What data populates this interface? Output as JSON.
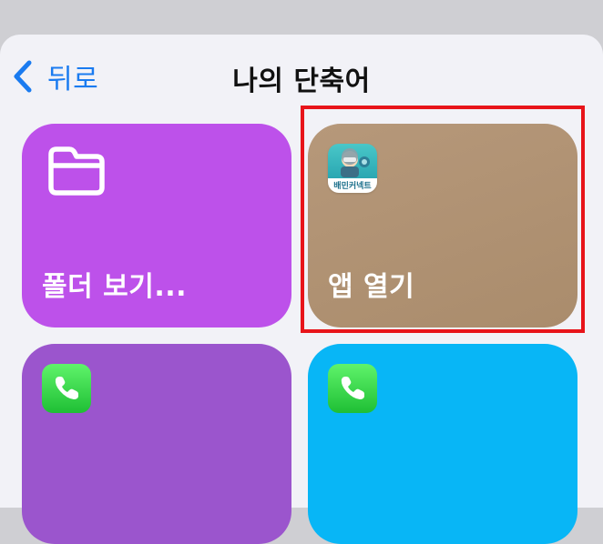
{
  "nav": {
    "back_label": "뒤로",
    "title": "나의 단축어"
  },
  "tiles": {
    "folder": {
      "label": "폴더 보기...",
      "color": "#bd51ea",
      "icon": "folder-icon"
    },
    "app": {
      "label": "앱 열기",
      "icon_text": "배민커넥트",
      "color": "#b09274",
      "icon": "app-icon"
    },
    "call1": {
      "color": "#9b55cd",
      "icon": "phone-icon"
    },
    "call2": {
      "color": "#08b6f6",
      "icon": "phone-icon"
    }
  },
  "colors": {
    "accent": "#1a7bf0",
    "highlight": "#e8141a",
    "sheet_bg": "#f2f2f7"
  }
}
